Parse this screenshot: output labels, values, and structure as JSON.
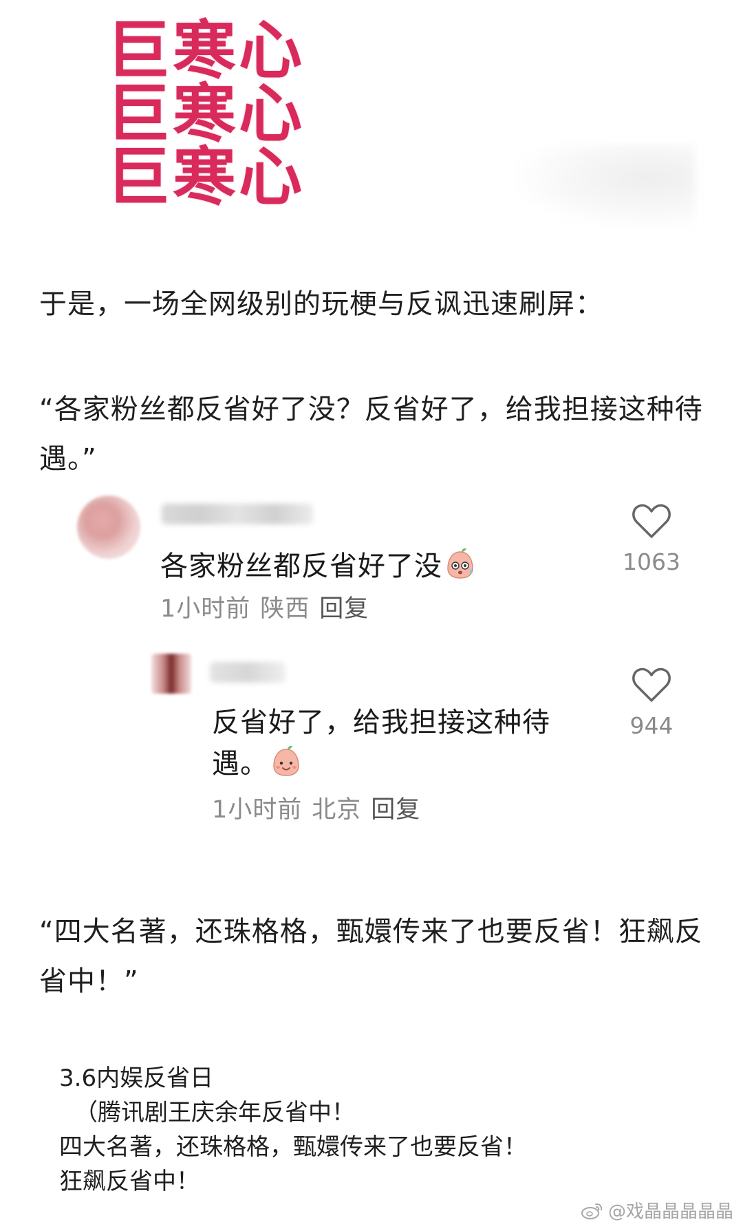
{
  "meme": {
    "lines": [
      "巨寒心",
      "巨寒心",
      "巨寒心"
    ]
  },
  "paragraphs": {
    "p1": "于是，一场全网级别的玩梗与反讽迅速刷屏：",
    "p2": "“各家粉丝都反省好了没？反省好了，给我担接这种待遇。”",
    "p3": "“四大名著，还珠格格，甄嬛传来了也要反省！狂飙反省中！”"
  },
  "comments": [
    {
      "text": "各家粉丝都反省好了没",
      "emoji": "sweating-peach-emoji",
      "time": "1小时前",
      "location": "陕西",
      "reply": "回复",
      "likes": "1063"
    },
    {
      "text": "反省好了，给我担接这种待遇。",
      "emoji": "smiling-peach-emoji",
      "time": "1小时前",
      "location": "北京",
      "reply": "回复",
      "likes": "944"
    }
  ],
  "note": {
    "line1": "3.6内娱反省日",
    "line2": "（腾讯剧王庆余年反省中！",
    "line3": "四大名著，还珠格格，甄嬛传来了也要反省！",
    "line4": "狂飙反省中！"
  },
  "watermark": {
    "text": "@戏晶晶晶晶晶",
    "icon": "weibo-icon"
  },
  "colors": {
    "meme_text": "#d92a5c",
    "meta_text": "#8a8a8a"
  }
}
